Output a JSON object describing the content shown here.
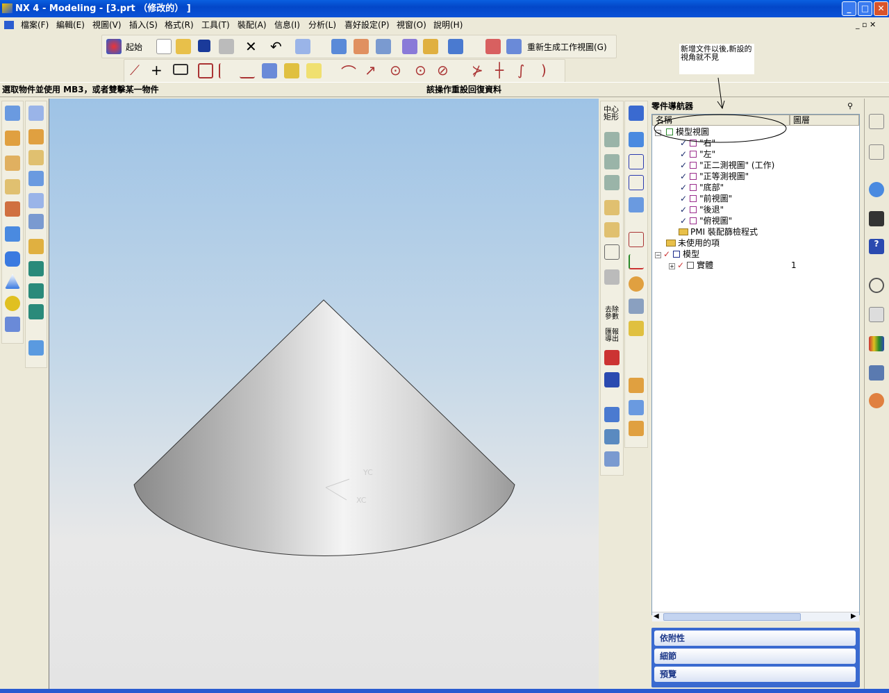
{
  "window": {
    "title": "NX 4 - Modeling - [3.prt （修改的） ]",
    "min": "_",
    "max": "□",
    "close": "✕"
  },
  "menu": [
    "檔案(F)",
    "編輯(E)",
    "視圖(V)",
    "插入(S)",
    "格式(R)",
    "工具(T)",
    "裝配(A)",
    "信息(I)",
    "分析(L)",
    "喜好設定(P)",
    "視窗(O)",
    "說明(H)"
  ],
  "toolbar": {
    "start_label": "起始",
    "regen_label": "重新生成工作視圖(G)"
  },
  "annotation": {
    "note": "新增文件以後,新設的視角就不見"
  },
  "status": {
    "left": "選取物件並使用 MB3，或者雙擊某一物件",
    "right": "該操作重設回復資料"
  },
  "viewtools": {
    "center_rect": "中心矩形",
    "remove_params": "去除參數",
    "export": "匯報導出"
  },
  "viewport": {
    "triad_y": "YC",
    "triad_x": "XC",
    "colors": {
      "top": "#9ec3e6",
      "bottom": "#e4e4e4"
    }
  },
  "navigator": {
    "title": "零件導航器",
    "columns": {
      "name": "名稱",
      "layer": "圖層"
    },
    "model_views": "模型視圖",
    "views": [
      "\"右\"",
      "\"左\"",
      "\"正二測視圖\" (工作)",
      "\"正等測視圖\"",
      "\"底部\"",
      "\"前視圖\"",
      "\"後退\"",
      "\"俯視圖\""
    ],
    "pmi": "PMI 裝配篩檢程式",
    "unused": "未使用的項",
    "model": "模型",
    "body": "實體",
    "body_layer": "1",
    "panels": [
      "依附性",
      "細節",
      "預覽"
    ]
  }
}
